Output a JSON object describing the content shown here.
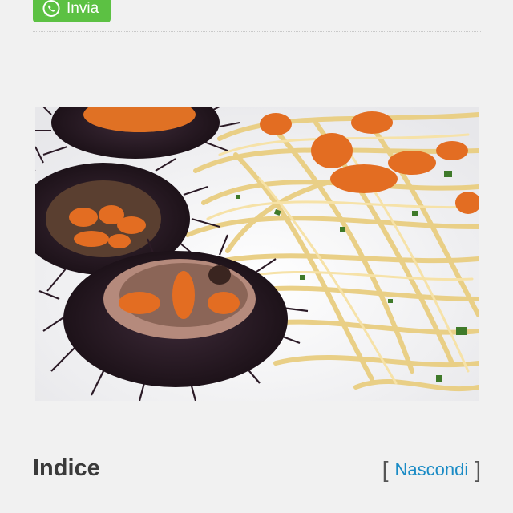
{
  "share": {
    "label": "Invia",
    "icon": "whatsapp-icon",
    "color": "#5cc143"
  },
  "article_image": {
    "alt": "Spaghetti ai ricci di mare"
  },
  "toc": {
    "title": "Indice",
    "bracket_open": "[",
    "toggle_label": "Nascondi",
    "bracket_close": "]",
    "link_color": "#1a8bc5"
  }
}
